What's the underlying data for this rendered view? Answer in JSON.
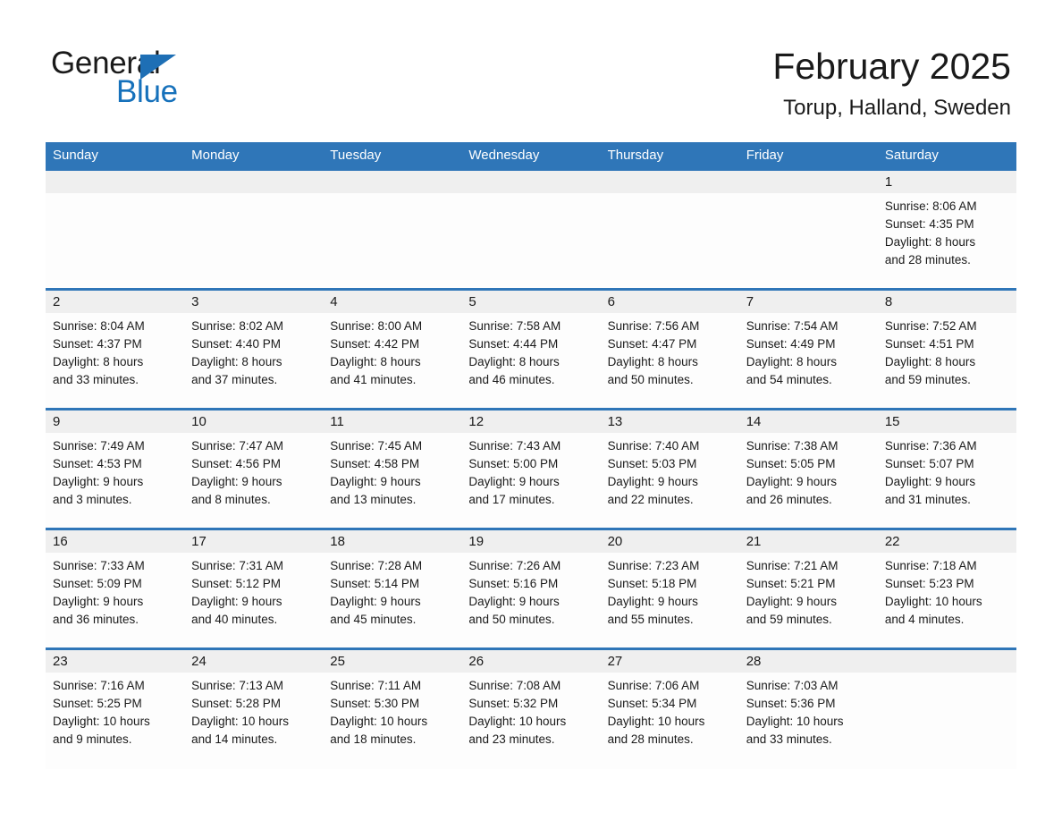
{
  "brand": {
    "name_part1": "General",
    "name_part2": "Blue",
    "accent_color": "#1671bb",
    "logo_triangle_color": "#1e6fb5"
  },
  "header": {
    "title": "February 2025",
    "subtitle": "Torup, Halland, Sweden"
  },
  "theme": {
    "header_blue": "#2f76b8",
    "daynum_band": "#efefef",
    "cell_background": "#fdfdfd"
  },
  "calendar": {
    "weekday_headers": [
      "Sunday",
      "Monday",
      "Tuesday",
      "Wednesday",
      "Thursday",
      "Friday",
      "Saturday"
    ],
    "labels": {
      "sunrise_prefix": "Sunrise:",
      "sunset_prefix": "Sunset:",
      "daylight_prefix": "Daylight:"
    },
    "weeks": [
      [
        {
          "day": "",
          "sunrise": "",
          "sunset": "",
          "daylight_line1": "",
          "daylight_line2": ""
        },
        {
          "day": "",
          "sunrise": "",
          "sunset": "",
          "daylight_line1": "",
          "daylight_line2": ""
        },
        {
          "day": "",
          "sunrise": "",
          "sunset": "",
          "daylight_line1": "",
          "daylight_line2": ""
        },
        {
          "day": "",
          "sunrise": "",
          "sunset": "",
          "daylight_line1": "",
          "daylight_line2": ""
        },
        {
          "day": "",
          "sunrise": "",
          "sunset": "",
          "daylight_line1": "",
          "daylight_line2": ""
        },
        {
          "day": "",
          "sunrise": "",
          "sunset": "",
          "daylight_line1": "",
          "daylight_line2": ""
        },
        {
          "day": "1",
          "sunrise": "Sunrise: 8:06 AM",
          "sunset": "Sunset: 4:35 PM",
          "daylight_line1": "Daylight: 8 hours",
          "daylight_line2": "and 28 minutes."
        }
      ],
      [
        {
          "day": "2",
          "sunrise": "Sunrise: 8:04 AM",
          "sunset": "Sunset: 4:37 PM",
          "daylight_line1": "Daylight: 8 hours",
          "daylight_line2": "and 33 minutes."
        },
        {
          "day": "3",
          "sunrise": "Sunrise: 8:02 AM",
          "sunset": "Sunset: 4:40 PM",
          "daylight_line1": "Daylight: 8 hours",
          "daylight_line2": "and 37 minutes."
        },
        {
          "day": "4",
          "sunrise": "Sunrise: 8:00 AM",
          "sunset": "Sunset: 4:42 PM",
          "daylight_line1": "Daylight: 8 hours",
          "daylight_line2": "and 41 minutes."
        },
        {
          "day": "5",
          "sunrise": "Sunrise: 7:58 AM",
          "sunset": "Sunset: 4:44 PM",
          "daylight_line1": "Daylight: 8 hours",
          "daylight_line2": "and 46 minutes."
        },
        {
          "day": "6",
          "sunrise": "Sunrise: 7:56 AM",
          "sunset": "Sunset: 4:47 PM",
          "daylight_line1": "Daylight: 8 hours",
          "daylight_line2": "and 50 minutes."
        },
        {
          "day": "7",
          "sunrise": "Sunrise: 7:54 AM",
          "sunset": "Sunset: 4:49 PM",
          "daylight_line1": "Daylight: 8 hours",
          "daylight_line2": "and 54 minutes."
        },
        {
          "day": "8",
          "sunrise": "Sunrise: 7:52 AM",
          "sunset": "Sunset: 4:51 PM",
          "daylight_line1": "Daylight: 8 hours",
          "daylight_line2": "and 59 minutes."
        }
      ],
      [
        {
          "day": "9",
          "sunrise": "Sunrise: 7:49 AM",
          "sunset": "Sunset: 4:53 PM",
          "daylight_line1": "Daylight: 9 hours",
          "daylight_line2": "and 3 minutes."
        },
        {
          "day": "10",
          "sunrise": "Sunrise: 7:47 AM",
          "sunset": "Sunset: 4:56 PM",
          "daylight_line1": "Daylight: 9 hours",
          "daylight_line2": "and 8 minutes."
        },
        {
          "day": "11",
          "sunrise": "Sunrise: 7:45 AM",
          "sunset": "Sunset: 4:58 PM",
          "daylight_line1": "Daylight: 9 hours",
          "daylight_line2": "and 13 minutes."
        },
        {
          "day": "12",
          "sunrise": "Sunrise: 7:43 AM",
          "sunset": "Sunset: 5:00 PM",
          "daylight_line1": "Daylight: 9 hours",
          "daylight_line2": "and 17 minutes."
        },
        {
          "day": "13",
          "sunrise": "Sunrise: 7:40 AM",
          "sunset": "Sunset: 5:03 PM",
          "daylight_line1": "Daylight: 9 hours",
          "daylight_line2": "and 22 minutes."
        },
        {
          "day": "14",
          "sunrise": "Sunrise: 7:38 AM",
          "sunset": "Sunset: 5:05 PM",
          "daylight_line1": "Daylight: 9 hours",
          "daylight_line2": "and 26 minutes."
        },
        {
          "day": "15",
          "sunrise": "Sunrise: 7:36 AM",
          "sunset": "Sunset: 5:07 PM",
          "daylight_line1": "Daylight: 9 hours",
          "daylight_line2": "and 31 minutes."
        }
      ],
      [
        {
          "day": "16",
          "sunrise": "Sunrise: 7:33 AM",
          "sunset": "Sunset: 5:09 PM",
          "daylight_line1": "Daylight: 9 hours",
          "daylight_line2": "and 36 minutes."
        },
        {
          "day": "17",
          "sunrise": "Sunrise: 7:31 AM",
          "sunset": "Sunset: 5:12 PM",
          "daylight_line1": "Daylight: 9 hours",
          "daylight_line2": "and 40 minutes."
        },
        {
          "day": "18",
          "sunrise": "Sunrise: 7:28 AM",
          "sunset": "Sunset: 5:14 PM",
          "daylight_line1": "Daylight: 9 hours",
          "daylight_line2": "and 45 minutes."
        },
        {
          "day": "19",
          "sunrise": "Sunrise: 7:26 AM",
          "sunset": "Sunset: 5:16 PM",
          "daylight_line1": "Daylight: 9 hours",
          "daylight_line2": "and 50 minutes."
        },
        {
          "day": "20",
          "sunrise": "Sunrise: 7:23 AM",
          "sunset": "Sunset: 5:18 PM",
          "daylight_line1": "Daylight: 9 hours",
          "daylight_line2": "and 55 minutes."
        },
        {
          "day": "21",
          "sunrise": "Sunrise: 7:21 AM",
          "sunset": "Sunset: 5:21 PM",
          "daylight_line1": "Daylight: 9 hours",
          "daylight_line2": "and 59 minutes."
        },
        {
          "day": "22",
          "sunrise": "Sunrise: 7:18 AM",
          "sunset": "Sunset: 5:23 PM",
          "daylight_line1": "Daylight: 10 hours",
          "daylight_line2": "and 4 minutes."
        }
      ],
      [
        {
          "day": "23",
          "sunrise": "Sunrise: 7:16 AM",
          "sunset": "Sunset: 5:25 PM",
          "daylight_line1": "Daylight: 10 hours",
          "daylight_line2": "and 9 minutes."
        },
        {
          "day": "24",
          "sunrise": "Sunrise: 7:13 AM",
          "sunset": "Sunset: 5:28 PM",
          "daylight_line1": "Daylight: 10 hours",
          "daylight_line2": "and 14 minutes."
        },
        {
          "day": "25",
          "sunrise": "Sunrise: 7:11 AM",
          "sunset": "Sunset: 5:30 PM",
          "daylight_line1": "Daylight: 10 hours",
          "daylight_line2": "and 18 minutes."
        },
        {
          "day": "26",
          "sunrise": "Sunrise: 7:08 AM",
          "sunset": "Sunset: 5:32 PM",
          "daylight_line1": "Daylight: 10 hours",
          "daylight_line2": "and 23 minutes."
        },
        {
          "day": "27",
          "sunrise": "Sunrise: 7:06 AM",
          "sunset": "Sunset: 5:34 PM",
          "daylight_line1": "Daylight: 10 hours",
          "daylight_line2": "and 28 minutes."
        },
        {
          "day": "28",
          "sunrise": "Sunrise: 7:03 AM",
          "sunset": "Sunset: 5:36 PM",
          "daylight_line1": "Daylight: 10 hours",
          "daylight_line2": "and 33 minutes."
        },
        {
          "day": "",
          "sunrise": "",
          "sunset": "",
          "daylight_line1": "",
          "daylight_line2": ""
        }
      ]
    ]
  }
}
